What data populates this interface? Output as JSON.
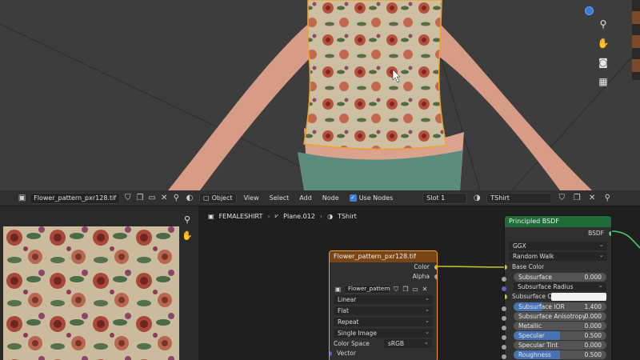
{
  "image_editor": {
    "image_name": "Flower_pattern_pxr128.tif"
  },
  "node_editor": {
    "menu": [
      "View",
      "Select",
      "Add",
      "Node"
    ],
    "object_mode": "Object",
    "use_nodes_label": "Use Nodes",
    "slot": "Slot 1",
    "material_name": "TShirt",
    "breadcrumb": [
      "FEMALESHIRT",
      "Plane.012",
      "TShirt"
    ]
  },
  "image_node": {
    "title": "Flower_pattern_pxr128.tif",
    "outputs": [
      "Color",
      "Alpha"
    ],
    "image_field": "Flower_pattern...",
    "interpolation": "Linear",
    "projection": "Flat",
    "extension": "Repeat",
    "source": "Single Image",
    "color_space_label": "Color Space",
    "color_space": "sRGB",
    "vector_label": "Vector"
  },
  "bsdf_node": {
    "title": "Principled BSDF",
    "output": "BSDF",
    "distribution": "GGX",
    "subsurface_method": "Random Walk",
    "base_color_label": "Base Color",
    "subsurface_radius_label": "Subsurface Radius",
    "subsurface_color_label": "Subsurface C",
    "sliders": [
      {
        "label": "Subsurface",
        "value": "0.000",
        "fill": 0.0
      },
      {
        "label": "Subsurface IOR",
        "value": "1.400",
        "fill": 0.3
      },
      {
        "label": "Subsurface Anisotropy",
        "value": "0.000",
        "fill": 0.0
      },
      {
        "label": "Metallic",
        "value": "0.000",
        "fill": 0.0
      },
      {
        "label": "Specular",
        "value": "0.500",
        "fill": 0.5
      },
      {
        "label": "Specular Tint",
        "value": "0.000",
        "fill": 0.0
      },
      {
        "label": "Roughness",
        "value": "0.500",
        "fill": 0.5
      }
    ]
  },
  "colors": {
    "accent_blue": "#4772b3",
    "image_node_header": "#7a4515",
    "bsdf_node_header": "#1f6b3a",
    "selection_orange": "#f0a030"
  }
}
